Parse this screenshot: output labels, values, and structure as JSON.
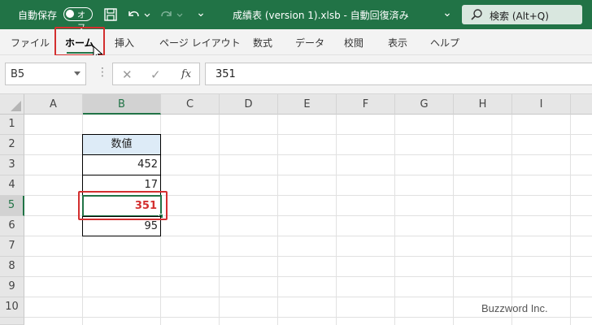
{
  "titlebar": {
    "autosave_label": "自動保存",
    "autosave_state": "オフ",
    "doc_title": "成績表 (version 1).xlsb  -  自動回復済み",
    "dropdown_glyph": "⌄",
    "search_placeholder": "検索 (Alt+Q)",
    "bg_color": "#217346"
  },
  "ribbon": {
    "tabs": [
      {
        "label": "ファイル"
      },
      {
        "label": "ホーム",
        "active": true
      },
      {
        "label": "挿入"
      },
      {
        "label": "ページ レイアウト"
      },
      {
        "label": "数式"
      },
      {
        "label": "データ"
      },
      {
        "label": "校閲"
      },
      {
        "label": "表示"
      },
      {
        "label": "ヘルプ"
      }
    ]
  },
  "formula_bar": {
    "name_box": "B5",
    "cancel_glyph": "✕",
    "enter_glyph": "✓",
    "fx_label": "fx",
    "content": "351",
    "dots": "⋮"
  },
  "grid": {
    "columns": [
      "A",
      "B",
      "C",
      "D",
      "E",
      "F",
      "G",
      "H",
      "I"
    ],
    "rows": [
      "1",
      "2",
      "3",
      "4",
      "5",
      "6",
      "7",
      "8",
      "9",
      "10"
    ],
    "selected_column": "B",
    "selected_row": "5",
    "cells": {
      "B2": "数値",
      "B3": "452",
      "B4": "17",
      "B5": "351",
      "B6": "95"
    },
    "header_fill": "#ddebf7",
    "highlight_color": "#d32f2f"
  },
  "watermark": "Buzzword Inc."
}
